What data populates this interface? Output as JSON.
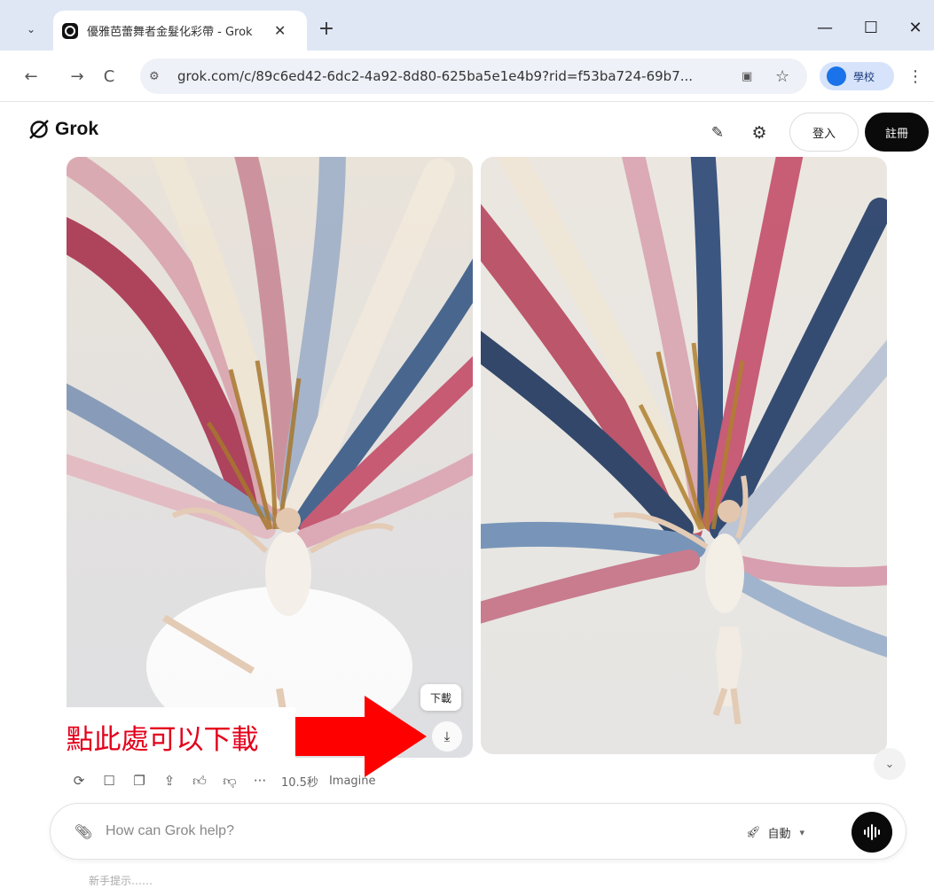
{
  "browser": {
    "tab_title": "優雅芭蕾舞者金髮化彩帶 - Grok",
    "url": "grok.com/c/89c6ed42-6dc2-4a92-8d80-625ba5e1e4b9?rid=f53ba724-69b7...",
    "profile_name": "學校",
    "tab_list_glyph": "⌄",
    "new_tab_glyph": "+",
    "minimize_glyph": "—",
    "maximize_glyph": "☐",
    "close_glyph": "✕",
    "back_glyph": "←",
    "forward_glyph": "→",
    "reload_glyph": "C",
    "menu_glyph": "⋮"
  },
  "header": {
    "logo_text": "Grok",
    "login_label": "登入",
    "signup_label": "註冊"
  },
  "images": {
    "download_tooltip": "下載"
  },
  "annotation": {
    "text": "點此處可以下載",
    "color": "#e3001b"
  },
  "actions": {
    "generation_time": "10.5秒",
    "model": "Imagine",
    "more_glyph": "···"
  },
  "composer": {
    "placeholder": "How can Grok help?",
    "mode_label": "自動"
  },
  "footer": {
    "hint": "新手提示……"
  },
  "icons": {
    "attach": "paperclip-icon",
    "mode": "rocket-icon",
    "voice": "waveform-icon"
  }
}
